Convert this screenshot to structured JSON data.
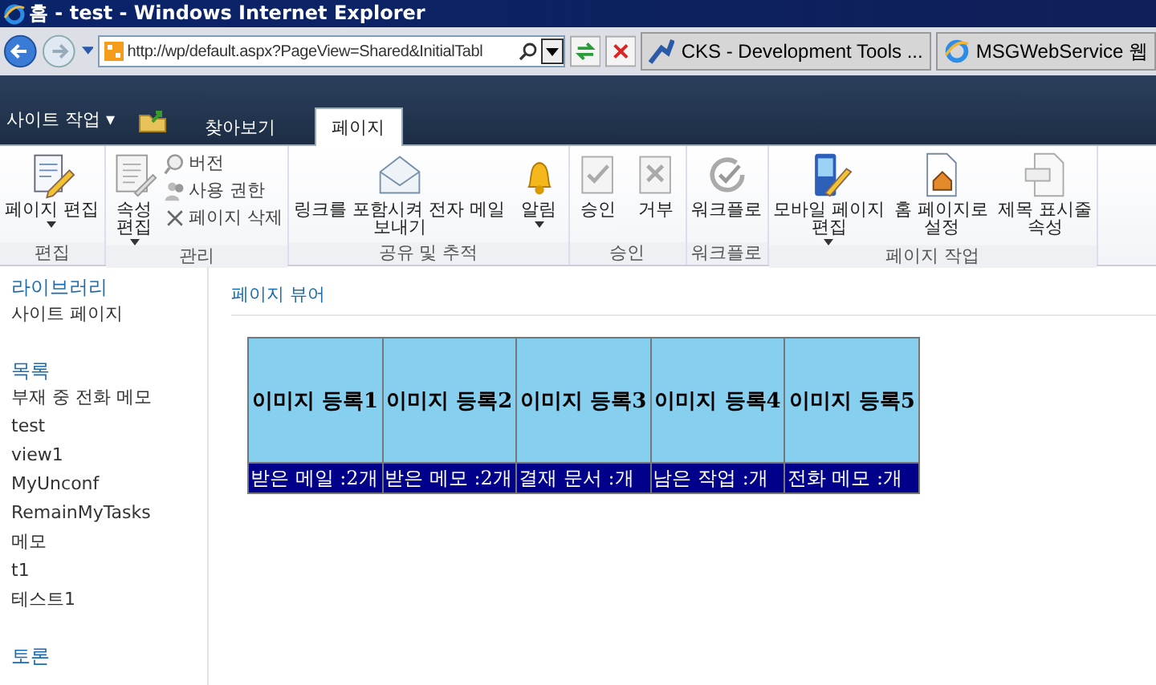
{
  "window": {
    "title": "홈 - test - Windows Internet Explorer"
  },
  "address_bar": {
    "url": "http://wp/default.aspx?PageView=Shared&InitialTabl"
  },
  "browser_tabs": [
    {
      "label": "CKS - Development Tools ...",
      "selected": false
    },
    {
      "label": "MSGWebService 웹",
      "selected": false
    }
  ],
  "ribbon": {
    "site_actions": "사이트 작업 ▾",
    "tabs": [
      {
        "label": "찾아보기",
        "selected": false
      },
      {
        "label": "페이지",
        "selected": true
      }
    ],
    "groups": [
      {
        "label": "편집",
        "buttons": [
          {
            "kind": "large",
            "label": "페이지 편집",
            "dropdown": true
          }
        ]
      },
      {
        "label": "관리",
        "buttons": [
          {
            "kind": "large",
            "label": "속성\n편집",
            "dropdown": true
          },
          {
            "kind": "small",
            "label": "버전"
          },
          {
            "kind": "small",
            "label": "사용 권한"
          },
          {
            "kind": "small",
            "label": "페이지 삭제"
          }
        ]
      },
      {
        "label": "공유 및 추적",
        "buttons": [
          {
            "kind": "large",
            "label": "링크를 포함시켜 전자 메일\n보내기",
            "dropdown": false
          },
          {
            "kind": "large",
            "label": "알림",
            "dropdown": true
          }
        ]
      },
      {
        "label": "승인",
        "buttons": [
          {
            "kind": "large",
            "label": "승인",
            "dropdown": false
          },
          {
            "kind": "large",
            "label": "거부",
            "dropdown": false
          }
        ]
      },
      {
        "label": "워크플로",
        "buttons": [
          {
            "kind": "large",
            "label": "워크플로",
            "dropdown": false
          }
        ]
      },
      {
        "label": "페이지 작업",
        "buttons": [
          {
            "kind": "large",
            "label": "모바일 페이지\n편집",
            "dropdown": true
          },
          {
            "kind": "large",
            "label": "홈 페이지로\n설정",
            "dropdown": false
          },
          {
            "kind": "large",
            "label": "제목 표시줄\n속성",
            "dropdown": false
          }
        ]
      }
    ]
  },
  "sidebar": {
    "sections": [
      {
        "heading": "라이브러리",
        "items": [
          "사이트 페이지"
        ]
      },
      {
        "heading": "목록",
        "items": [
          "부재 중 전화 메모",
          "test",
          "view1",
          "MyUnconf",
          "RemainMyTasks",
          "메모",
          "t1",
          "테스트1"
        ]
      },
      {
        "heading": "토론"
      }
    ]
  },
  "content": {
    "heading": "페이지 뷰어",
    "tiles": [
      {
        "title": "이미지 등록1",
        "caption": "받은 메일 :2개"
      },
      {
        "title": "이미지 등록2",
        "caption": "받은 메모 :2개"
      },
      {
        "title": "이미지 등록3",
        "caption": "결재 문서 :개"
      },
      {
        "title": "이미지 등록4",
        "caption": "남은 작업 :개"
      },
      {
        "title": "이미지 등록5",
        "caption": "전화 메모 :개"
      }
    ]
  }
}
